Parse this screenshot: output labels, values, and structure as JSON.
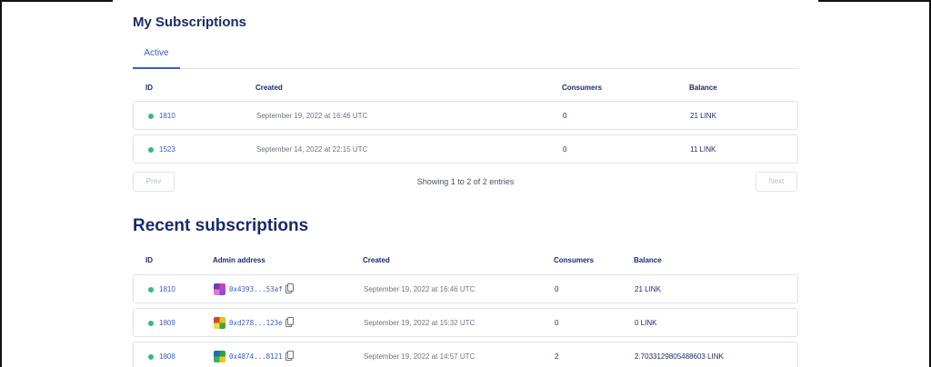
{
  "my_subscriptions": {
    "title": "My Subscriptions",
    "tab": "Active",
    "columns": {
      "id": "ID",
      "created": "Created",
      "consumers": "Consumers",
      "balance": "Balance"
    },
    "rows": [
      {
        "id": "1810",
        "created": "September 19, 2022 at 16:46 UTC",
        "consumers": "0",
        "balance": "21 LINK"
      },
      {
        "id": "1523",
        "created": "September 14, 2022 at 22:15 UTC",
        "consumers": "0",
        "balance": "11 LINK"
      }
    ],
    "prev_label": "Prev",
    "next_label": "Next",
    "pagination_info": "Showing 1 to 2 of 2 entries"
  },
  "recent_subscriptions": {
    "title": "Recent subscriptions",
    "columns": {
      "id": "ID",
      "admin": "Admin address",
      "created": "Created",
      "consumers": "Consumers",
      "balance": "Balance"
    },
    "rows": [
      {
        "id": "1810",
        "admin": "0x4393...53af",
        "created": "September 19, 2022 at 16:46 UTC",
        "consumers": "0",
        "balance": "21 LINK"
      },
      {
        "id": "1809",
        "admin": "0xd278...123e",
        "created": "September 19, 2022 at 15:32 UTC",
        "consumers": "0",
        "balance": "0 LINK"
      },
      {
        "id": "1808",
        "admin": "0x4874...8121",
        "created": "September 19, 2022 at 14:57 UTC",
        "consumers": "2",
        "balance": "2.7033129805488603 LINK"
      }
    ]
  },
  "colors": {
    "accent": "#375bd2",
    "heading": "#1a2b6b",
    "active_dot": "#3cb878",
    "border": "#dfe3ea"
  }
}
